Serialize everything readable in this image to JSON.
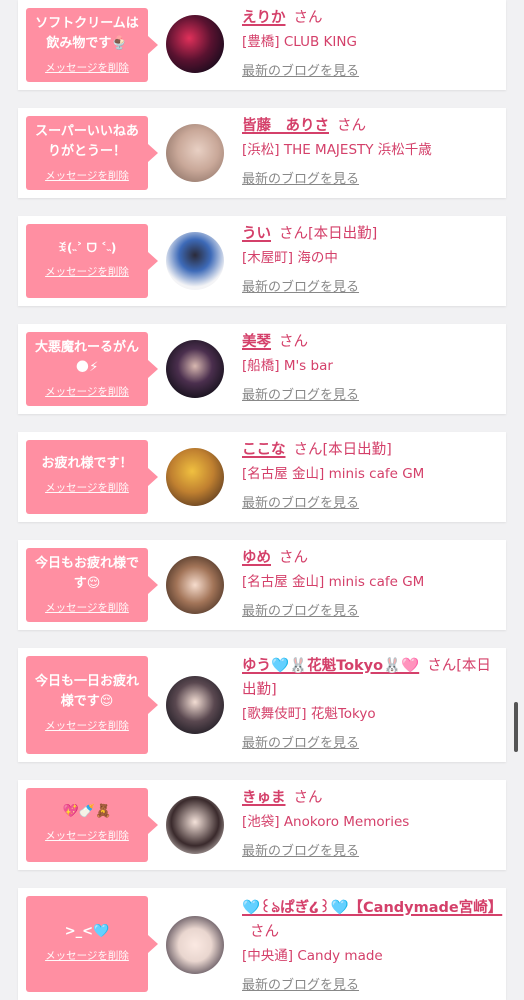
{
  "cards": [
    {
      "message": "ソフトクリームは飲み物です🍨",
      "delete_label": "メッセージを削除",
      "name": "えりか",
      "honorific": "さん",
      "status": "",
      "shop": "[豊橋] CLUB KING",
      "blog_link": "最新のブログを見る"
    },
    {
      "message": "スーパーいいねありがとうー！",
      "delete_label": "メッセージを削除",
      "name": "皆藤　ありさ",
      "honorific": "さん",
      "status": "",
      "shop": "[浜松] THE MAJESTY 浜松千歳",
      "blog_link": "最新のブログを見る"
    },
    {
      "message": "ꉂ(˵˃ ᗜ ˂˵)",
      "delete_label": "メッセージを削除",
      "name": "うい",
      "honorific": "さん",
      "status": "[本日出勤]",
      "shop": "[木屋町] 海の中",
      "blog_link": "最新のブログを見る"
    },
    {
      "message": "大悪魔れーるがん🌑⚡",
      "delete_label": "メッセージを削除",
      "name": "美琴",
      "honorific": "さん",
      "status": "",
      "shop": "[船橋] M's bar",
      "blog_link": "最新のブログを見る"
    },
    {
      "message": "お疲れ様です！",
      "delete_label": "メッセージを削除",
      "name": "ここな",
      "honorific": "さん",
      "status": "[本日出勤]",
      "shop": "[名古屋 金山] minis cafe GM",
      "blog_link": "最新のブログを見る"
    },
    {
      "message": "今日もお疲れ様です😌",
      "delete_label": "メッセージを削除",
      "name": "ゆめ",
      "honorific": "さん",
      "status": "",
      "shop": "[名古屋 金山] minis cafe GM",
      "blog_link": "最新のブログを見る"
    },
    {
      "message": "今日も一日お疲れ様です😌",
      "delete_label": "メッセージを削除",
      "name": "ゆう🩵🐰花魁Tokyo🐰🩷",
      "honorific": "さん",
      "status": "[本日出勤]",
      "shop": "[歌舞伎町] 花魁Tokyo",
      "blog_link": "最新のブログを見る"
    },
    {
      "message": "💖🍼🧸",
      "delete_label": "メッセージを削除",
      "name": "きゅま",
      "honorific": "さん",
      "status": "",
      "shop": "[池袋] Anokoro Memories",
      "blog_link": "最新のブログを見る"
    },
    {
      "message": ">_<🩵",
      "delete_label": "メッセージを削除",
      "name": "🩵꒰ঌぱぎ໒꒱🩵【Candymade宮崎】",
      "honorific": "さん",
      "status": "",
      "shop": "[中央通] Candy made",
      "blog_link": "最新のブログを見る"
    }
  ],
  "colors": {
    "accent": "#d4406a",
    "bubble": "#ff8fa2",
    "link_gray": "#888888"
  },
  "icons": [
    "avatar-photo"
  ]
}
